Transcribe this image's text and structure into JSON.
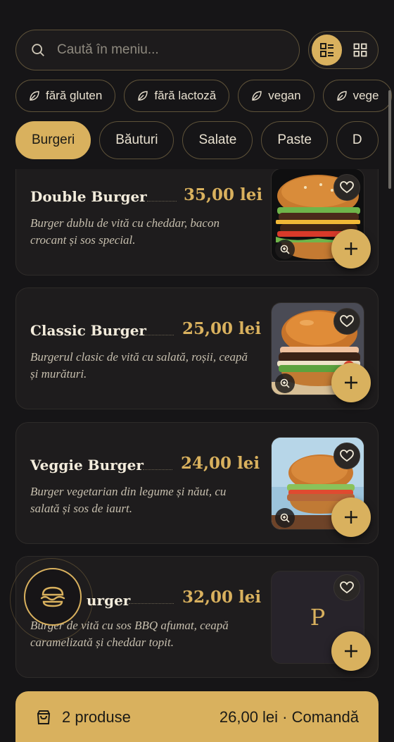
{
  "search": {
    "placeholder": "Caută în meniu..."
  },
  "view_toggle": {
    "active": "list"
  },
  "filters": [
    {
      "label": "fără gluten",
      "icon": "leaf-icon"
    },
    {
      "label": "fără lactoză",
      "icon": "leaf-icon"
    },
    {
      "label": "vegan",
      "icon": "leaf-icon"
    },
    {
      "label": "vege",
      "icon": "leaf-icon"
    }
  ],
  "categories": [
    {
      "label": "Burgeri",
      "active": true
    },
    {
      "label": "Băuturi",
      "active": false
    },
    {
      "label": "Salate",
      "active": false
    },
    {
      "label": "Paste",
      "active": false
    },
    {
      "label": "D",
      "active": false
    }
  ],
  "products": [
    {
      "name": "Double Burger",
      "price": "35,00 lei",
      "description": "Burger dublu de vită cu cheddar, bacon crocant și sos special.",
      "image": "double-burger-photo"
    },
    {
      "name": "Classic Burger",
      "price": "25,00 lei",
      "description": "Burgerul clasic de vită cu salată, roșii, ceapă și murături.",
      "image": "classic-burger-photo"
    },
    {
      "name": "Veggie Burger",
      "price": "24,00 lei",
      "description": "Burger vegetarian din legume și năut, cu salată și sos de iaurt.",
      "image": "veggie-burger-photo"
    },
    {
      "name": "BBQ Burger",
      "name_visible": "urger",
      "price": "32,00 lei",
      "description": "Burger de vită cu sos BBQ afumat, ceapă caramelizată și cheddar topit.",
      "image_placeholder": "P"
    }
  ],
  "cart": {
    "count": "2 produse",
    "total": "26,00 lei · Comandă"
  },
  "colors": {
    "accent": "#d9b15e",
    "background": "#161517",
    "card": "#1e1c1d"
  }
}
